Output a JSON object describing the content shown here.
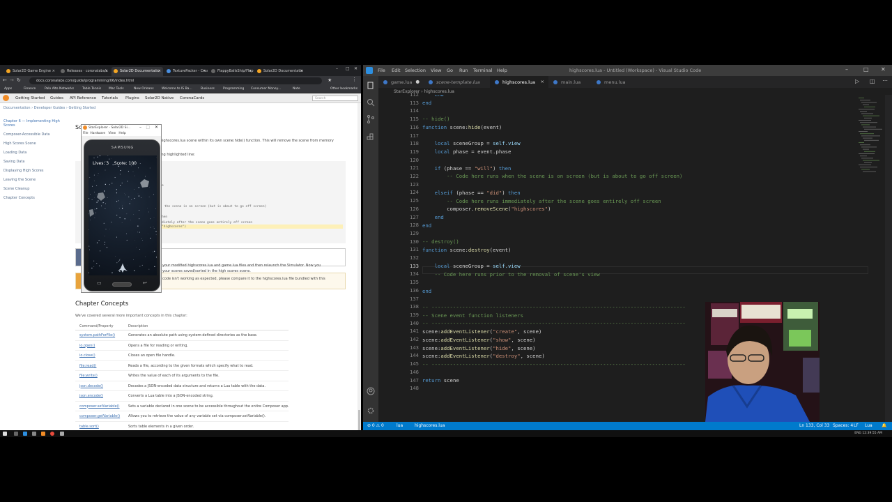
{
  "browser": {
    "tabs": [
      {
        "label": "Solar2D Game Engine",
        "color": "#f5a623"
      },
      {
        "label": "Releases · coronalabs/c",
        "color": "#666666"
      },
      {
        "label": "Solar2D Documentatio",
        "color": "#f5a623",
        "active": true
      },
      {
        "label": "TexturePacker - Create",
        "color": "#4a90e2"
      },
      {
        "label": "FlappyBallsShip/Flappy",
        "color": "#666666"
      },
      {
        "label": "Solar2D Documentatio",
        "color": "#f5a623"
      }
    ],
    "url": "docs.coronalabs.com/guide/programming/06/index.html",
    "bookmarks": [
      "Apps",
      "Finance",
      "Palo Alto Networks",
      "Table Tennis",
      "Mac Tools",
      "New Orleans",
      "Welcome to IS Ba...",
      "Business",
      "Programming",
      "Consumer Money...",
      "Note",
      "Other bookmarks"
    ],
    "site_nav": [
      "Getting Started",
      "Guides",
      "API Reference",
      "Tutorials",
      "Plugins",
      "Solar2D Native",
      "CoronaCards"
    ],
    "search_placeholder": "Search",
    "breadcrumb": "Documentation  ›  Developer Guides  ›  Getting Started",
    "sidebar": [
      "Chapter 6 — Implementing High Scores",
      "Composer-Accessible Data",
      "High Scores Scene",
      "Loading Data",
      "Saving Data",
      "Displaying High Scores",
      "Leaving the Scene",
      "Scene Cleanup",
      "Chapter Concepts"
    ],
    "section_heading_fragment": "Sc",
    "text_remove": "highscores.lua scene within its own scene:hide() function. This will remove the scene from memory",
    "text_following": "ing highlighted line:",
    "code_fragments": [
      "e",
      "n",
      "the scene is on screen (but is about to go off screen)",
      "hen",
      "diately after the scene goes entirely off screen",
      "\"highscores\")"
    ],
    "callout1": "your modified highscores.lua and game.lua files and then relaunch the Simulator. Now you\nyour scores saved/sorted in the high scores scene.",
    "callout2": "code isn't working as expected, please compare it to the highscores.lua file bundled with this",
    "concepts_title": "Chapter Concepts",
    "concepts_intro": "We've covered several more important concepts in this chapter:",
    "concepts_headers": [
      "Command/Property",
      "Description"
    ],
    "concepts": [
      {
        "prop": "system.pathForFile()",
        "desc": "Generates an absolute path using system-defined directories as the base."
      },
      {
        "prop": "io.open()",
        "desc": "Opens a file for reading or writing."
      },
      {
        "prop": "io.close()",
        "desc": "Closes an open file handle."
      },
      {
        "prop": "file:read()",
        "desc": "Reads a file, according to the given formats which specify what to read."
      },
      {
        "prop": "file:write()",
        "desc": "Writes the value of each of its arguments to the file."
      },
      {
        "prop": "json.decode()",
        "desc": "Decodes a JSON-encoded data structure and returns a Lua table with the data."
      },
      {
        "prop": "json.encode()",
        "desc": "Converts a Lua table into a JSON-encoded string."
      },
      {
        "prop": "composer.setVariable()",
        "desc": "Sets a variable declared in one scene to be accessible throughout the entire Composer app."
      },
      {
        "prop": "composer.getVariable()",
        "desc": "Allows you to retrieve the value of any variable set via composer.setVariable()."
      },
      {
        "prop": "table.sort()",
        "desc": "Sorts table elements in a given order."
      }
    ]
  },
  "simulator": {
    "title": "StarExplorer - Solar2D Si...",
    "menu": [
      "File",
      "Hardware",
      "View",
      "Help"
    ],
    "brand": "SAMSUNG",
    "lives_label": "Lives: 3",
    "score_label": "Score: 100"
  },
  "vscode": {
    "menu": [
      "File",
      "Edit",
      "Selection",
      "View",
      "Go",
      "Run",
      "Terminal",
      "Help"
    ],
    "window_title": "highscores.lua - Untitled (Workspace) - Visual Studio Code",
    "tabs": [
      {
        "label": "game.lua",
        "modified": true
      },
      {
        "label": "scene-template.lua",
        "italic": true
      },
      {
        "label": "highscores.lua",
        "active": true
      },
      {
        "label": "main.lua"
      },
      {
        "label": "menu.lua"
      }
    ],
    "breadcrumb": "StarExplorer  ›  highscores.lua",
    "line_numbers": [
      "112",
      "113",
      "114",
      "115",
      "116",
      "117",
      "118",
      "119",
      "120",
      "121",
      "122",
      "123",
      "124",
      "125",
      "126",
      "127",
      "128",
      "129",
      "130",
      "131",
      "132",
      "133",
      "134",
      "135",
      "136",
      "137",
      "138",
      "139",
      "140",
      "141",
      "142",
      "143",
      "144",
      "145",
      "146",
      "147",
      "148"
    ],
    "status": {
      "errors": "⊘ 0  ⚠ 0",
      "lang_task": "lua",
      "file": "highscores.lua",
      "position": "Ln 133, Col 33",
      "spaces": "Spaces: 4",
      "eol": "LF",
      "mode": "Lua"
    }
  },
  "taskbar": {
    "tray": "ENG  12:39:55 AM"
  }
}
